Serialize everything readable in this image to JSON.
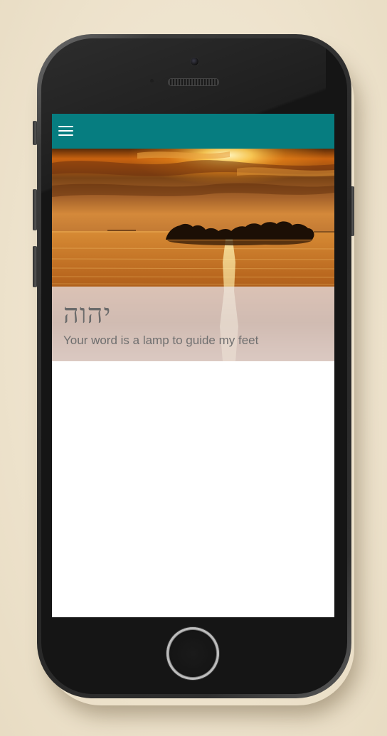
{
  "app_bar": {
    "menu_icon": "hamburger-menu-icon",
    "color": "#067d80"
  },
  "hero": {
    "image": "sunset-over-lake-with-island",
    "title": "יהוה",
    "tagline": "Your word is a lamp to guide my feet"
  },
  "device": {
    "frame": "smartphone",
    "home_button_icon": "home-button-ring"
  }
}
